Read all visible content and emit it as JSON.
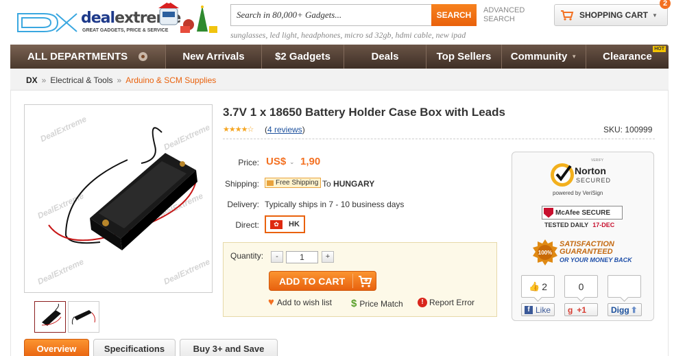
{
  "header": {
    "logo_dx": "DX",
    "logo_deal": "deal",
    "logo_extreme": "extreme",
    "logo_tagline": "GREAT GADGETS, PRICE & SERVICE",
    "search_placeholder": "Search in 80,000+ Gadgets...",
    "search_button": "SEARCH",
    "advanced_search": "ADVANCED SEARCH",
    "suggestions": "sunglasses, led light, headphones, micro sd 32gb, hdmi cable, new ipad",
    "cart_label": "SHOPPING CART",
    "cart_count": "2"
  },
  "nav": {
    "all_departments": "ALL DEPARTMENTS",
    "items": [
      "New Arrivals",
      "$2 Gadgets",
      "Deals",
      "Top Sellers",
      "Community",
      "Clearance"
    ],
    "hot_badge": "HOT"
  },
  "breadcrumb": {
    "root": "DX",
    "level1": "Electrical & Tools",
    "current": "Arduino & SCM Supplies",
    "separator": "»"
  },
  "product": {
    "title": "3.7V 1 x 18650 Battery Holder Case Box with Leads",
    "rating_stars": "★★★★☆",
    "rating": 4,
    "reviews": "4 reviews",
    "sku_label": "SKU:",
    "sku": "100999",
    "watermark": "DealExtreme",
    "price_label": "Price:",
    "currency": "US$",
    "price": "1,90",
    "shipping_label": "Shipping:",
    "shipping_badge": "Free Shipping",
    "shipping_to": "To",
    "shipping_country": "HUNGARY",
    "delivery_label": "Delivery:",
    "delivery_value": "Typically ships in 7 - 10 business days",
    "direct_label": "Direct:",
    "direct_code": "HK",
    "quantity_label": "Quantity:",
    "quantity": "1",
    "add_to_cart": "ADD TO CART",
    "wish_list": "Add to wish list",
    "price_match": "Price Match",
    "report_error": "Report Error"
  },
  "trust": {
    "norton_verify": "VERIFY",
    "norton_name": "Norton",
    "norton_secured": "SECURED",
    "norton_powered": "powered by VeriSign",
    "mcafee": "McAfee SECURE",
    "mcafee_tested": "TESTED DAILY",
    "mcafee_date": "17-DEC",
    "seal_100": "100%",
    "satisfaction_line1": "SATISFACTION",
    "satisfaction_line2": "GUARANTEED",
    "satisfaction_sub": "OR YOUR MONEY BACK"
  },
  "social": {
    "fb_count": "2",
    "fb_label": "Like",
    "g_count": "0",
    "g_label": "+1",
    "digg_count": "",
    "digg_label": "Digg"
  },
  "tabs": [
    "Overview",
    "Specifications",
    "Buy 3+ and Save"
  ],
  "colors": {
    "accent": "#f37021",
    "nav": "#4a392d",
    "link": "#1a4f9c"
  }
}
